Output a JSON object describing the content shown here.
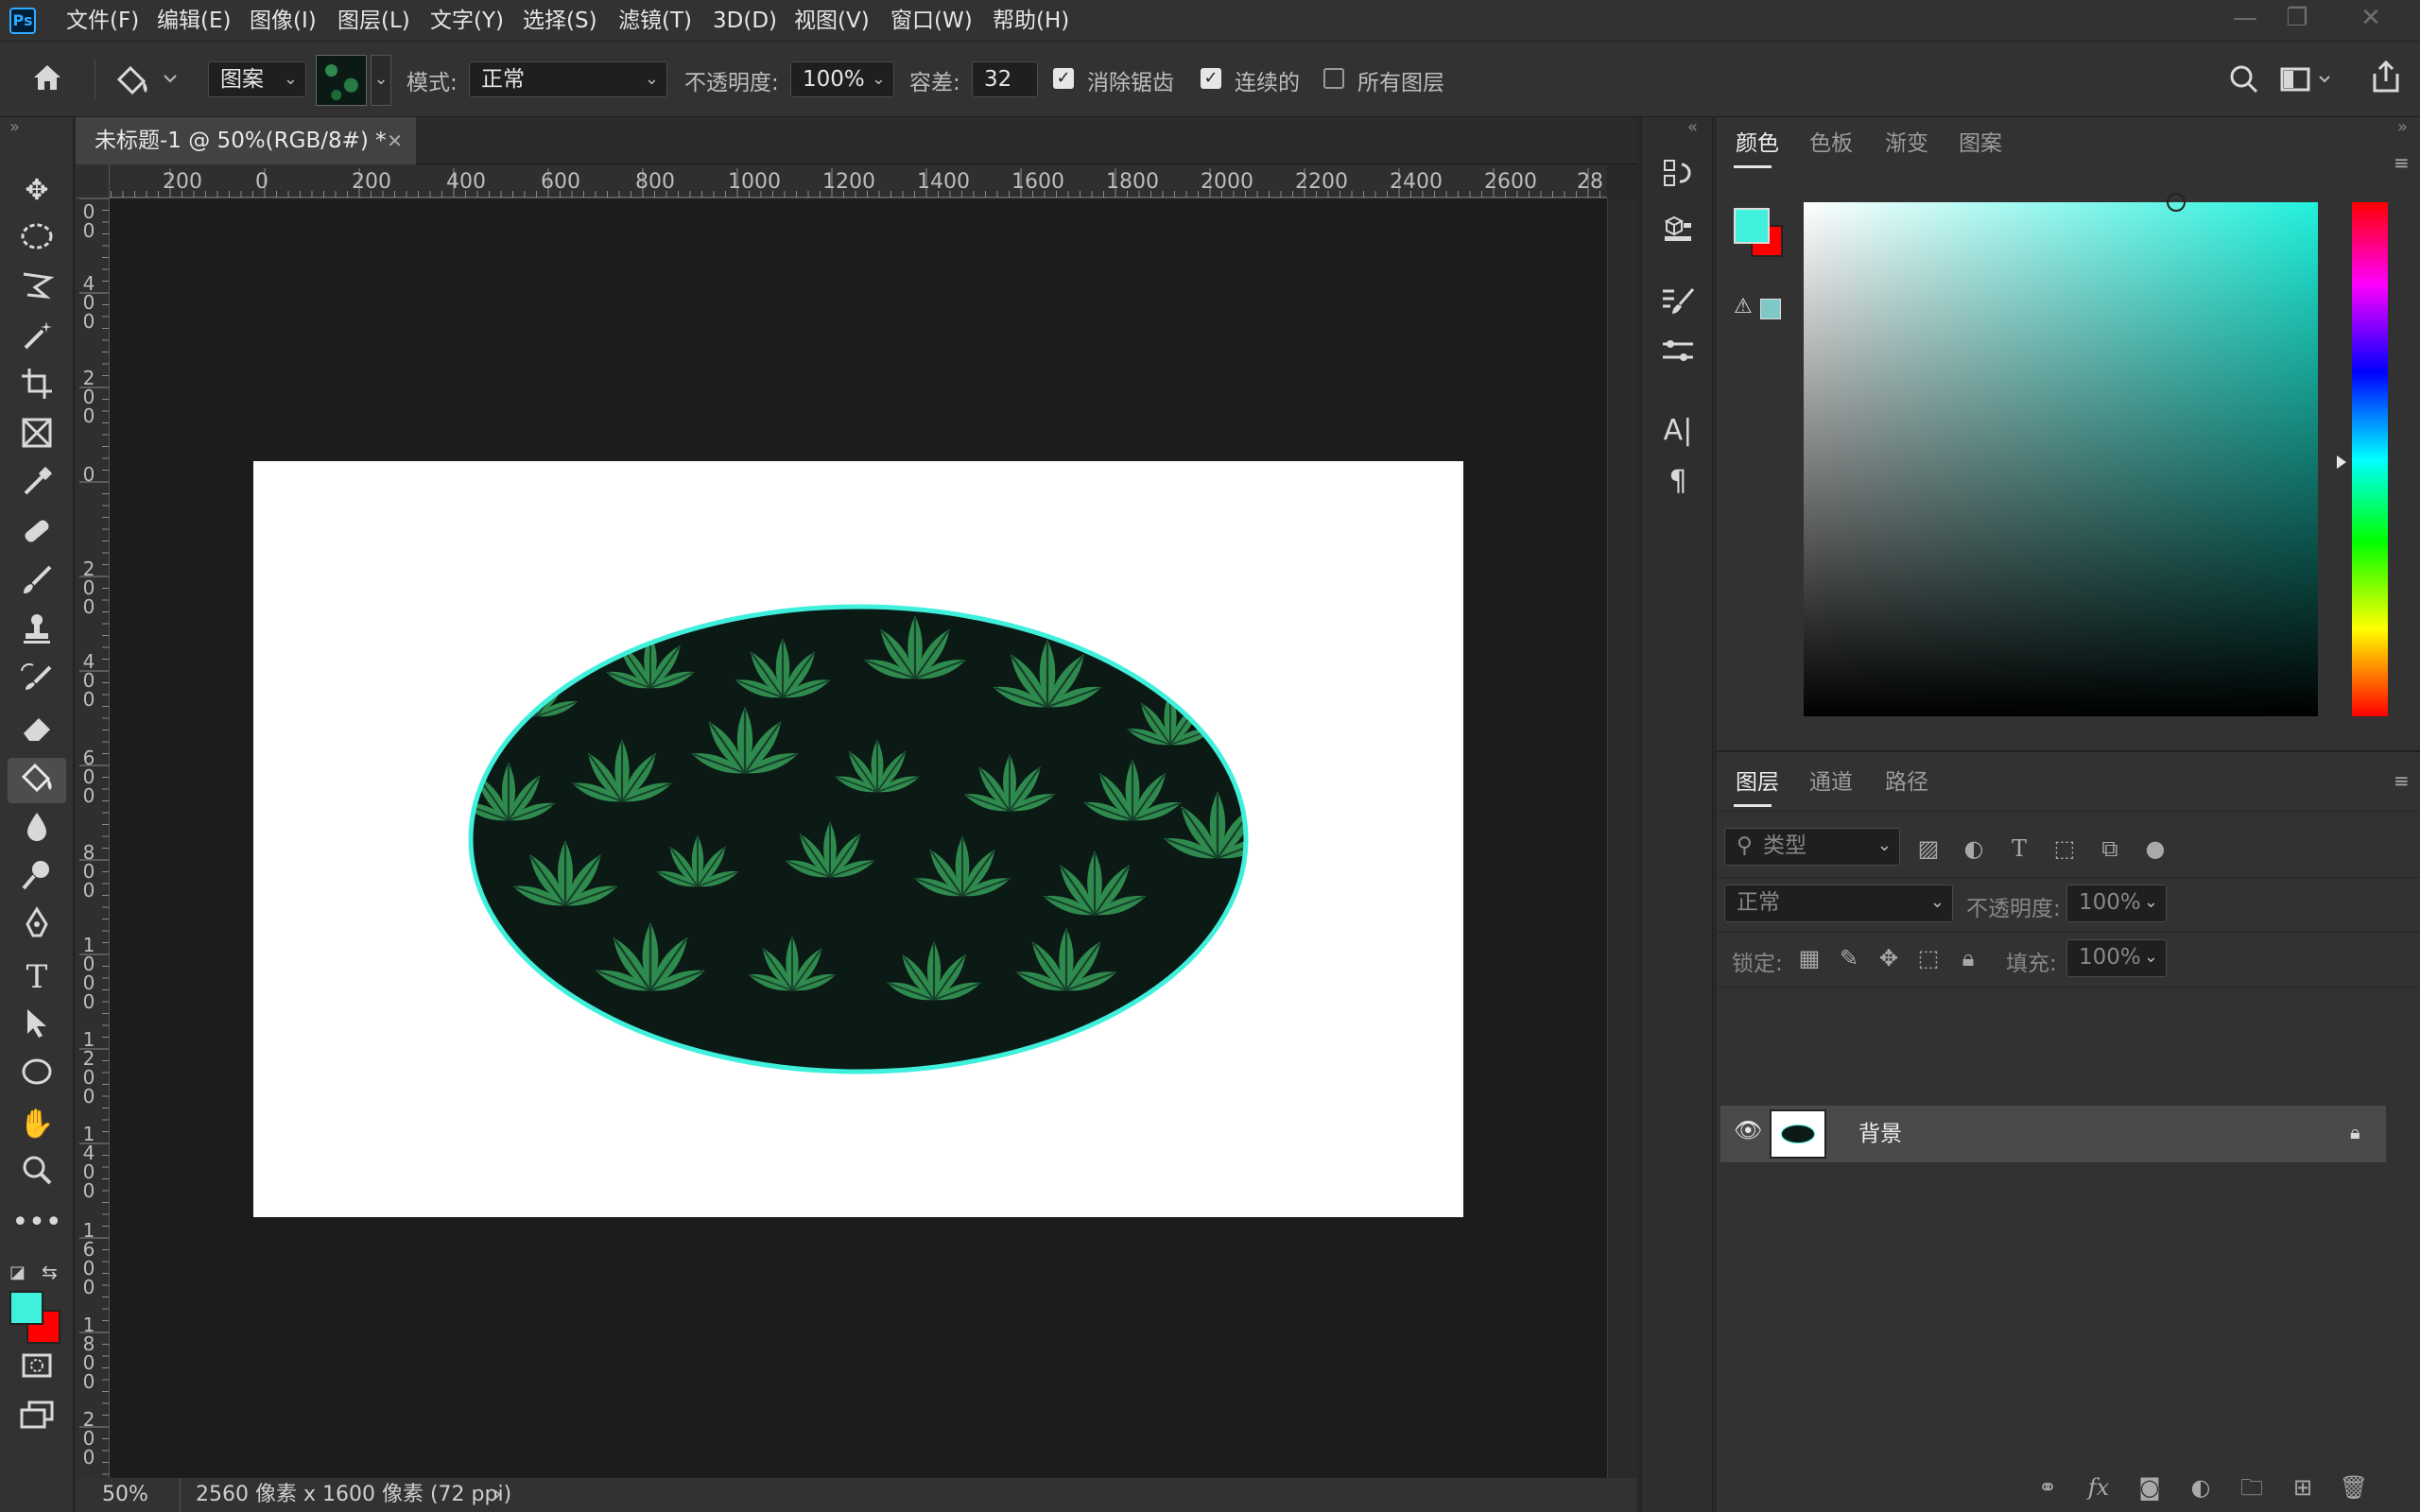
{
  "app": {
    "name": "Photoshop",
    "logo_text": "Ps"
  },
  "menu": [
    "文件(F)",
    "编辑(E)",
    "图像(I)",
    "图层(L)",
    "文字(Y)",
    "选择(S)",
    "滤镜(T)",
    "3D(D)",
    "视图(V)",
    "窗口(W)",
    "帮助(H)"
  ],
  "options": {
    "fill_source": "图案",
    "mode_label": "模式:",
    "mode_value": "正常",
    "opacity_label": "不透明度:",
    "opacity_value": "100%",
    "tolerance_label": "容差:",
    "tolerance_value": "32",
    "antialias_label": "消除锯齿",
    "antialias_checked": true,
    "contiguous_label": "连续的",
    "contiguous_checked": true,
    "all_layers_label": "所有图层",
    "all_layers_checked": false
  },
  "document": {
    "tab_title": "未标题-1 @ 50%(RGB/8#) *",
    "zoom": "50%",
    "info": "2560 像素 x 1600 像素 (72 ppi)",
    "h_ruler_labels": [
      "200",
      "0",
      "200",
      "400",
      "600",
      "800",
      "1000",
      "1200",
      "1400",
      "1600",
      "1800",
      "2000",
      "2200",
      "2400",
      "2600",
      "28"
    ],
    "v_ruler_labels": [
      "0 0",
      "4 0 0",
      "2 0 0",
      "0",
      "2 0 0",
      "4 0 0",
      "6 0 0",
      "8 0 0",
      "1 0 0 0",
      "1 2 0 0",
      "1 4 0 0",
      "1 6 0 0",
      "1 8 0 0",
      "2 0 0"
    ]
  },
  "color_panel": {
    "tabs": [
      "颜色",
      "色板",
      "渐变",
      "图案"
    ],
    "active_tab": "颜色",
    "foreground": "#3ff0dc",
    "background": "#ff0000",
    "spectrum_hue": "#21f0dc"
  },
  "layers_panel": {
    "tabs": [
      "图层",
      "通道",
      "路径"
    ],
    "active_tab": "图层",
    "filter_placeholder": "类型",
    "blend_mode": "正常",
    "opacity_label": "不透明度:",
    "opacity_value": "100%",
    "lock_label": "锁定:",
    "fill_label": "填充:",
    "fill_value": "100%",
    "layers": [
      {
        "name": "背景",
        "visible": true,
        "locked": true
      }
    ]
  },
  "toolbar_tools": [
    "move-tool",
    "elliptical-marquee-tool",
    "polygonal-lasso-tool",
    "magic-wand-tool",
    "crop-tool",
    "frame-tool",
    "eyedropper-tool",
    "healing-brush-tool",
    "brush-tool",
    "clone-stamp-tool",
    "history-brush-tool",
    "eraser-tool",
    "paint-bucket-tool",
    "blur-tool",
    "dodge-tool",
    "pen-tool",
    "type-tool",
    "path-selection-tool",
    "ellipse-tool",
    "hand-tool",
    "zoom-tool",
    "more-tools"
  ],
  "colors": {
    "accent": "#31a8ff",
    "ellipse_stroke": "#3ff0dc",
    "leaf_dark": "#0b1a15",
    "leaf_green": "#2f8a4e"
  }
}
